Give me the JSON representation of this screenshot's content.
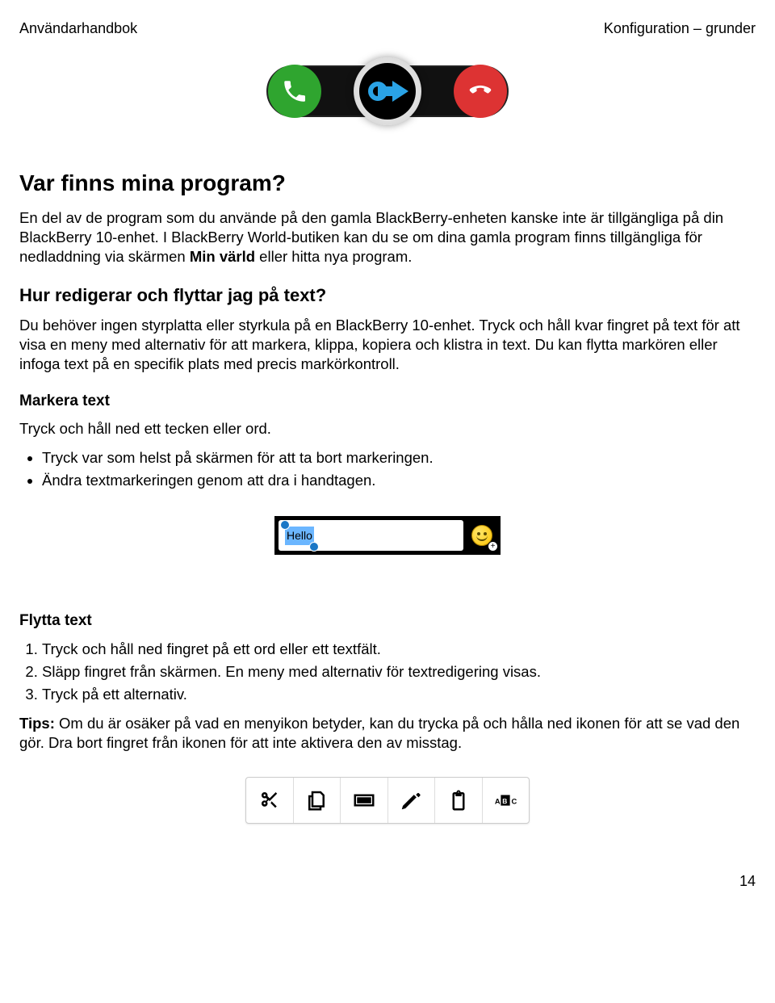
{
  "header": {
    "left": "Användarhandbok",
    "right": "Konfiguration – grunder"
  },
  "call_slider": {
    "answer_icon": "phone-answer-icon",
    "decline_icon": "phone-decline-icon",
    "slider_direction": "right"
  },
  "section1": {
    "heading": "Var finns mina program?",
    "p1a": "En del av de program som du använde på den gamla BlackBerry-enheten kanske inte är tillgängliga på din BlackBerry 10-enhet. I BlackBerry World-butiken kan du se om dina gamla program finns tillgängliga för nedladdning via skärmen ",
    "p1b_bold": "Min värld",
    "p1c": " eller hitta nya program."
  },
  "section2": {
    "heading": "Hur redigerar och flyttar jag på text?",
    "p1": "Du behöver ingen styrplatta eller styrkula på en BlackBerry 10-enhet. Tryck och håll kvar fingret på text för att visa en meny med alternativ för att markera, klippa, kopiera och klistra in text. Du kan flytta markören eller infoga text på en specifik plats med precis markörkontroll."
  },
  "section3": {
    "heading": "Markera text",
    "p1": "Tryck och håll ned ett tecken eller ord.",
    "bullets": [
      "Tryck var som helst på skärmen för att ta bort markeringen.",
      "Ändra textmarkeringen genom att dra i handtagen."
    ]
  },
  "text_input": {
    "selected_text": "Hello"
  },
  "section4": {
    "heading": "Flytta text",
    "steps": [
      "Tryck och håll ned fingret på ett ord eller ett textfält.",
      "Släpp fingret från skärmen. En meny med alternativ för textredigering visas.",
      "Tryck på ett alternativ."
    ],
    "tip_label_bold": "Tips:",
    "tip": " Om du är osäker på vad en menyikon betyder, kan du trycka på och hålla ned ikonen för att se vad den gör. Dra bort fingret från ikonen för att inte aktivera den av misstag."
  },
  "toolbar_icons": [
    "cut-icon",
    "copy-icon",
    "select-icon",
    "edit-icon",
    "paste-icon",
    "select-all-icon"
  ],
  "page_number": "14"
}
